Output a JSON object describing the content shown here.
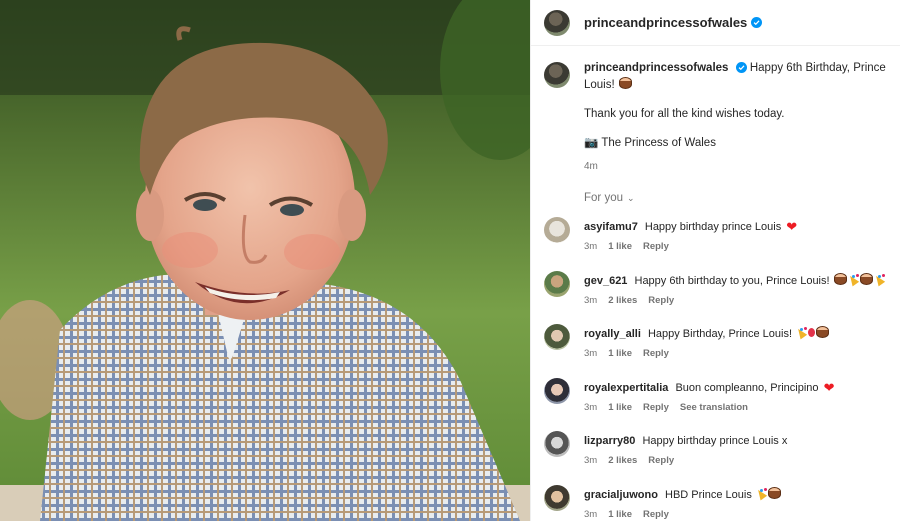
{
  "post": {
    "username": "princeandprincessofwales",
    "verified": true,
    "caption": {
      "username": "princeandprincessofwales",
      "text": "Happy 6th Birthday, Prince Louis!",
      "line2": "Thank you for all the kind wishes today.",
      "camera_icon": "📷",
      "line3": "The Princess of Wales",
      "time": "4m"
    },
    "sort_label": "For you",
    "colors": {
      "accent": "#0095f6",
      "heart": "#ed1c24",
      "muted": "#737373"
    }
  },
  "comments": [
    {
      "username": "asyifamu7",
      "text": "Happy birthday prince Louis",
      "emoji": [
        "heart"
      ],
      "time": "3m",
      "likes": "1 like",
      "reply": "Reply",
      "extra": ""
    },
    {
      "username": "gev_621",
      "text": "Happy 6th birthday to you, Prince Louis!",
      "emoji": [
        "cake",
        "party",
        "cake",
        "party"
      ],
      "time": "3m",
      "likes": "2 likes",
      "reply": "Reply",
      "extra": ""
    },
    {
      "username": "royally_alli",
      "text": "Happy Birthday, Prince Louis!",
      "emoji": [
        "party",
        "balloon",
        "cake"
      ],
      "time": "3m",
      "likes": "1 like",
      "reply": "Reply",
      "extra": ""
    },
    {
      "username": "royalexpertitalia",
      "text": "Buon compleanno, Principino",
      "emoji": [
        "heart"
      ],
      "time": "3m",
      "likes": "1 like",
      "reply": "Reply",
      "extra": "See translation"
    },
    {
      "username": "lizparry80",
      "text": "Happy birthday prince Louis x",
      "emoji": [],
      "time": "3m",
      "likes": "2 likes",
      "reply": "Reply",
      "extra": ""
    },
    {
      "username": "gracialjuwono",
      "text": "HBD Prince Louis",
      "emoji": [
        "party",
        "cake"
      ],
      "time": "3m",
      "likes": "1 like",
      "reply": "Reply",
      "extra": ""
    }
  ]
}
